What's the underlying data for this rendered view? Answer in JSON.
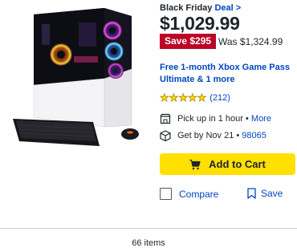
{
  "product": {
    "promo_label": "Black Friday",
    "promo_link": "Deal >",
    "price": "$1,029.99",
    "save_badge": "Save $295",
    "was_price": "Was $1,324.99",
    "offer": "Free 1-month Xbox Game Pass Ultimate & 1 more",
    "rating": {
      "stars": 5,
      "review_count": "(212)"
    },
    "pickup": {
      "text": "Pick up in 1 hour",
      "separator": " • ",
      "link": "More"
    },
    "delivery": {
      "text": "Get by Nov 21",
      "separator": " • ",
      "link": "98065"
    },
    "add_to_cart": "Add to Cart",
    "compare": "Compare",
    "save": "Save"
  },
  "results": {
    "count_label": "66 items"
  },
  "colors": {
    "accent_blue": "#0046be",
    "sale_red": "#bb0628",
    "cart_yellow": "#ffe000"
  },
  "icons": [
    "star-icon",
    "store-icon",
    "package-icon",
    "cart-icon",
    "bookmark-icon"
  ]
}
